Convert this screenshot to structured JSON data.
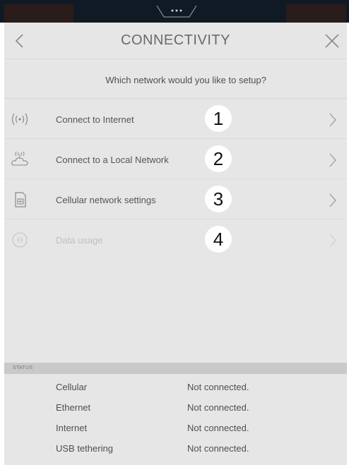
{
  "header": {
    "title": "CONNECTIVITY",
    "back_icon": "chevron-left-icon",
    "close_icon": "close-icon"
  },
  "question": "Which network would you like to setup?",
  "menu": [
    {
      "label": "Connect to Internet",
      "number": "1",
      "icon": "wireless-signal-icon",
      "enabled": true
    },
    {
      "label": "Connect to a Local Network",
      "number": "2",
      "icon": "cloud-network-icon",
      "enabled": true
    },
    {
      "label": "Cellular network settings",
      "number": "3",
      "icon": "sim-card-icon",
      "enabled": true
    },
    {
      "label": "Data usage",
      "number": "4",
      "icon": "data-usage-icon",
      "enabled": false
    }
  ],
  "status": {
    "header": "STATUS",
    "rows": [
      {
        "name": "Cellular",
        "value": "Not connected."
      },
      {
        "name": "Ethernet",
        "value": "Not connected."
      },
      {
        "name": "Internet",
        "value": "Not connected."
      },
      {
        "name": "USB tethering",
        "value": "Not connected."
      }
    ]
  },
  "colors": {
    "background": "#e6e6e6",
    "status_header": "#c9c9c9",
    "top_bar": "#0f1a24",
    "text": "#4f4f4f",
    "disabled_text": "#c0c0c0"
  }
}
